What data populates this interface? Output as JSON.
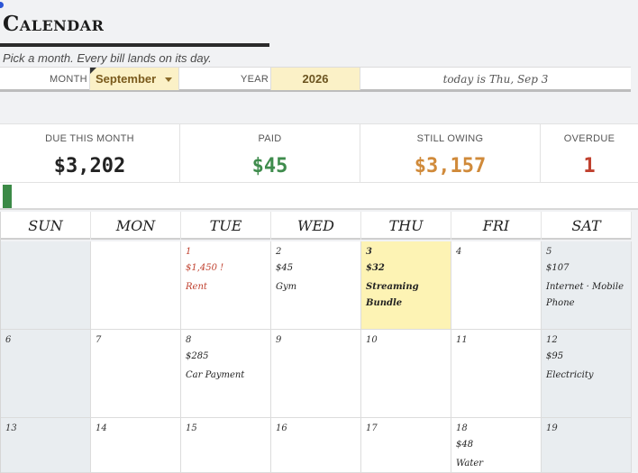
{
  "header": {
    "title": "Calendar",
    "subtitle": "Pick a month. Every bill lands on its day."
  },
  "controls": {
    "month_label": "MONTH",
    "month_value": "September",
    "year_label": "YEAR",
    "year_value": "2026",
    "today_text": "today is Thu, Sep 3"
  },
  "stats": {
    "due": {
      "label": "DUE THIS MONTH",
      "value": "$3,202",
      "color": "#222222"
    },
    "paid": {
      "label": "PAID",
      "value": "$45",
      "color": "#3f8c4d"
    },
    "owing": {
      "label": "STILL OWING",
      "value": "$3,157",
      "color": "#d08a3a"
    },
    "overdue": {
      "label": "OVERDUE",
      "value": "1",
      "color": "#c0412f"
    }
  },
  "progress": {
    "paid_fraction": 0.014,
    "color": "#3c8a47"
  },
  "calendar": {
    "weekdays": [
      "SUN",
      "MON",
      "TUE",
      "WED",
      "THU",
      "FRI",
      "SAT"
    ],
    "days": {
      "d1": {
        "num": "1",
        "amount": "$1,450 !",
        "name": "Rent"
      },
      "d2": {
        "num": "2",
        "amount": "$45",
        "name": "Gym"
      },
      "d3": {
        "num": "3",
        "amount": "$32",
        "name": "Streaming Bundle"
      },
      "d4": {
        "num": "4"
      },
      "d5": {
        "num": "5",
        "amount": "$107",
        "name": "Internet · Mobile Phone"
      },
      "d6": {
        "num": "6"
      },
      "d7": {
        "num": "7"
      },
      "d8": {
        "num": "8",
        "amount": "$285",
        "name": "Car Payment"
      },
      "d9": {
        "num": "9"
      },
      "d10": {
        "num": "10"
      },
      "d11": {
        "num": "11"
      },
      "d12": {
        "num": "12",
        "amount": "$95",
        "name": "Electricity"
      },
      "d13": {
        "num": "13"
      },
      "d14": {
        "num": "14"
      },
      "d15": {
        "num": "15"
      },
      "d16": {
        "num": "16"
      },
      "d17": {
        "num": "17"
      },
      "d18": {
        "num": "18",
        "amount": "$48",
        "name": "Water"
      },
      "d19": {
        "num": "19"
      }
    }
  }
}
